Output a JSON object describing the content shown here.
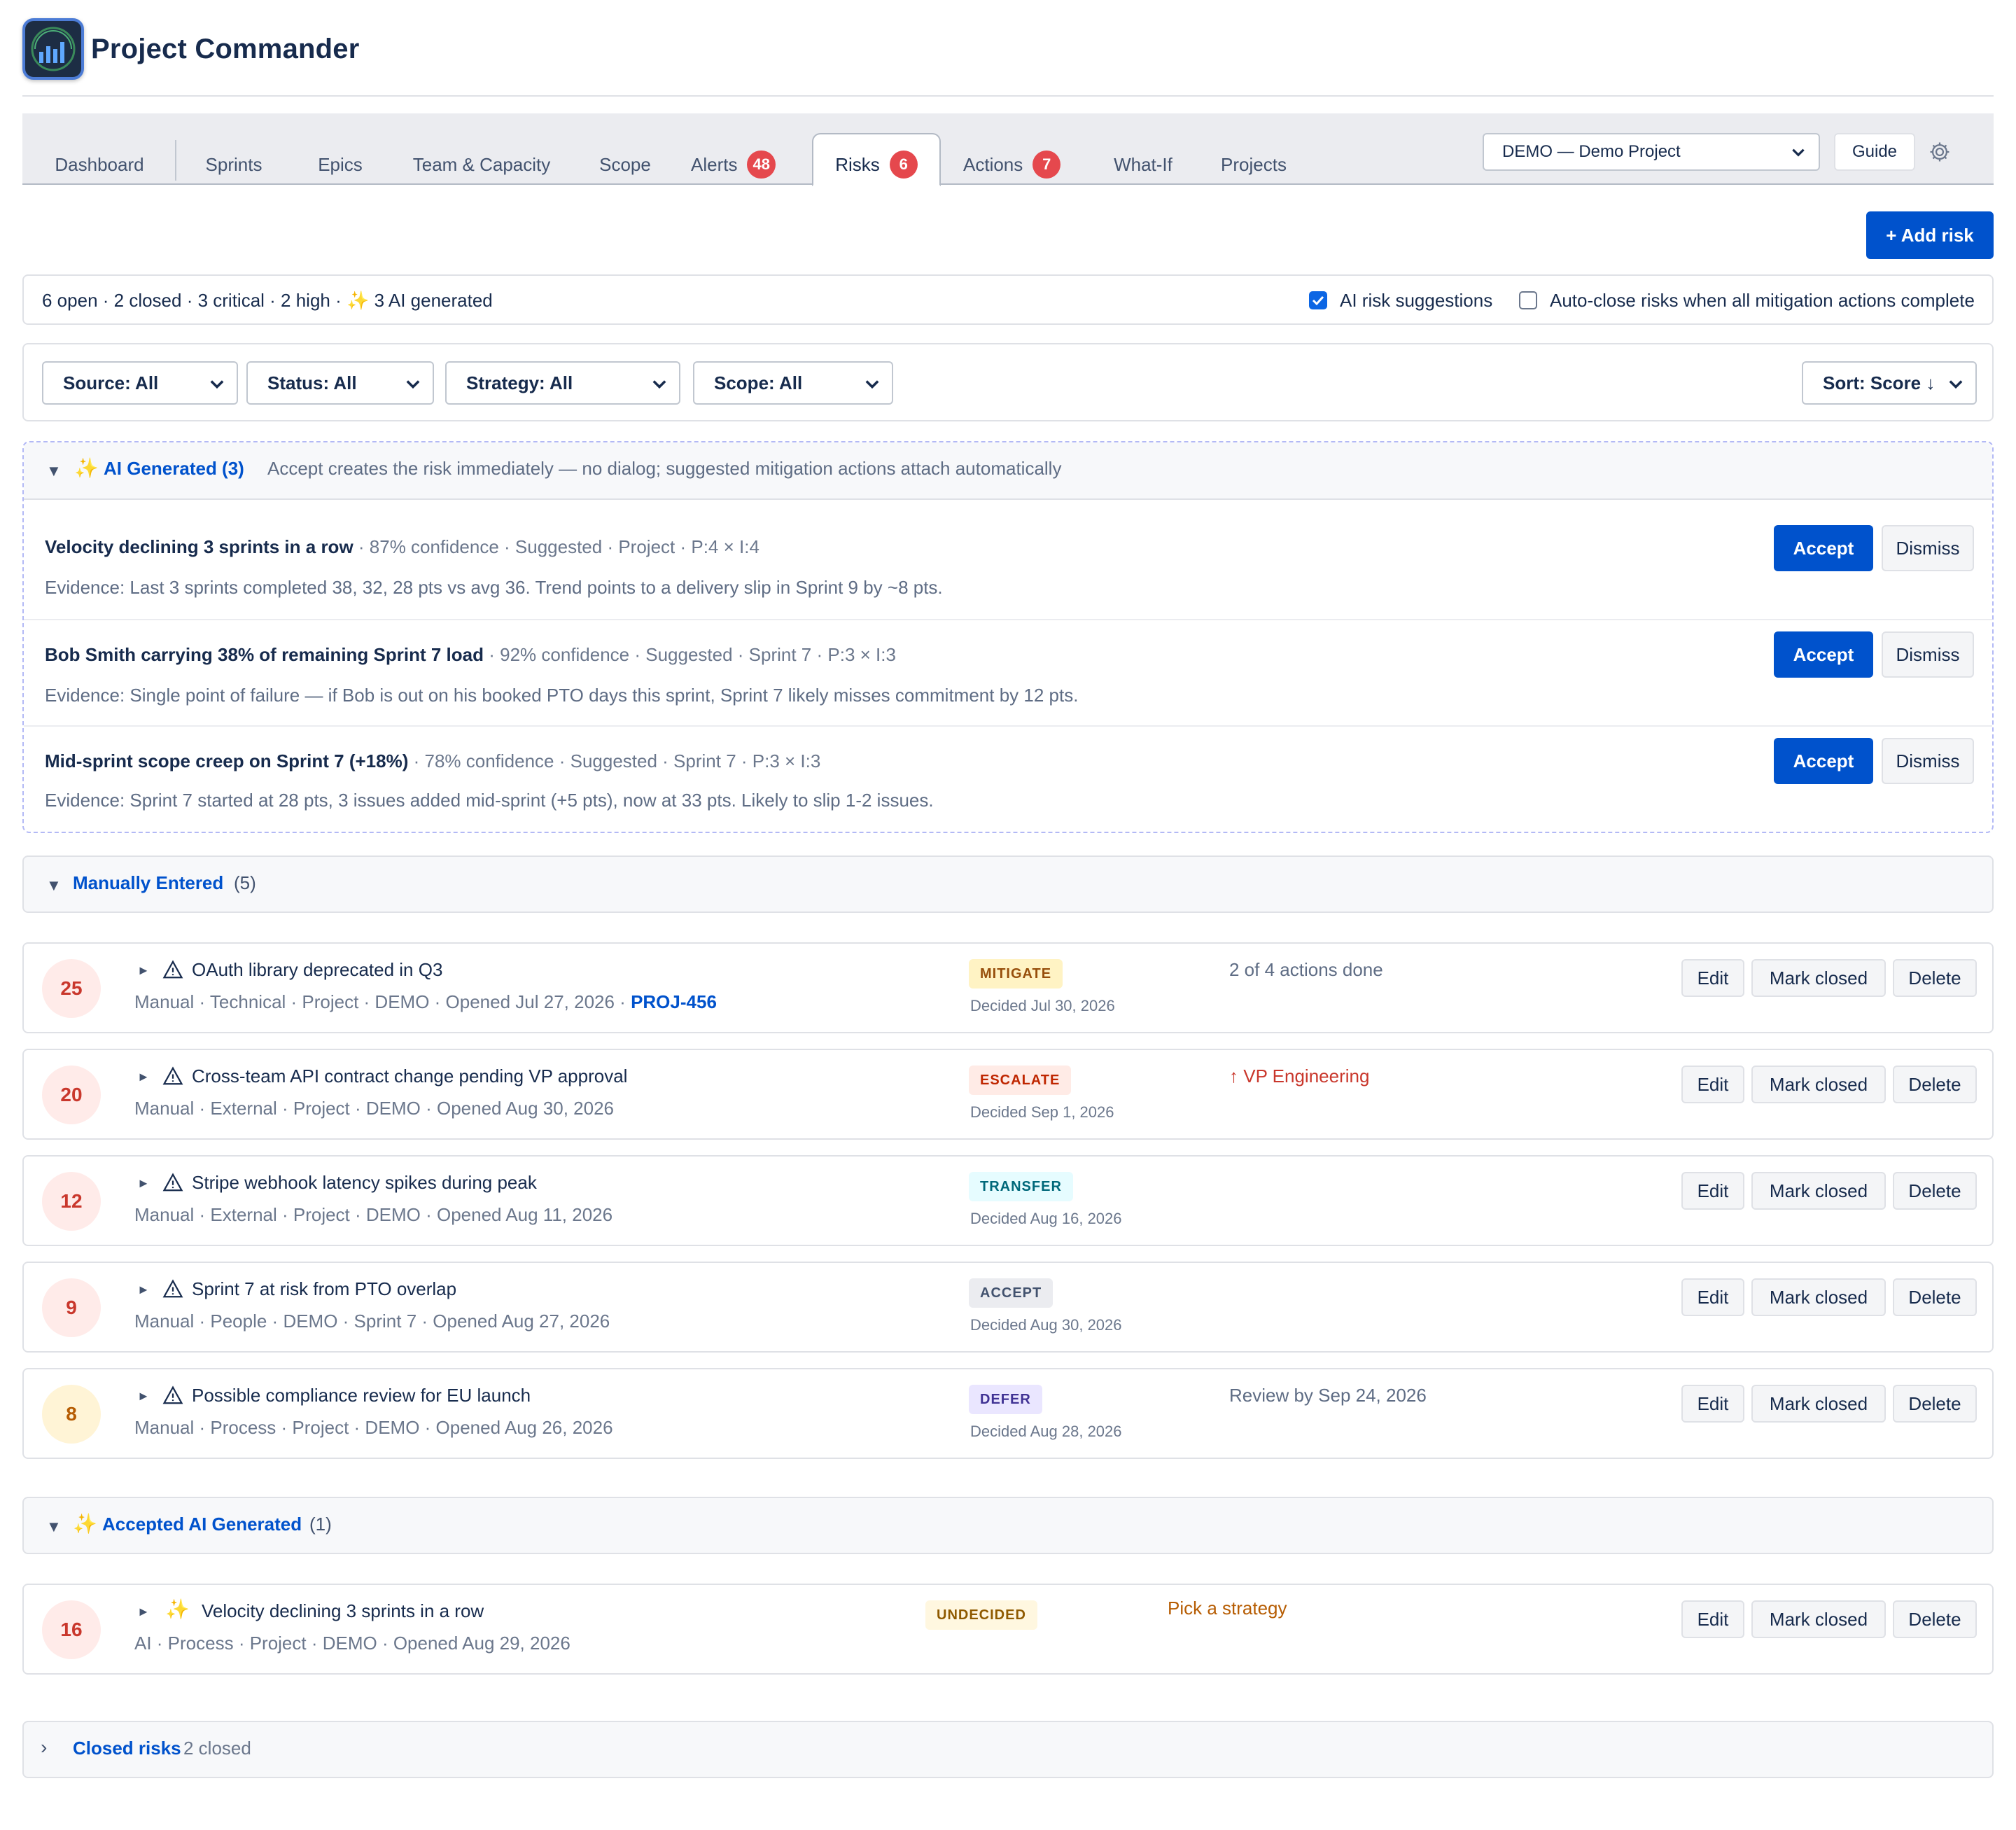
{
  "app": {
    "title": "Project Commander"
  },
  "tabs": [
    {
      "label": "Dashboard"
    },
    {
      "label": "Sprints"
    },
    {
      "label": "Epics"
    },
    {
      "label": "Team & Capacity"
    },
    {
      "label": "Scope"
    },
    {
      "label": "Alerts",
      "badge": "48"
    },
    {
      "label": "Risks",
      "badge": "6",
      "active": true
    },
    {
      "label": "Actions",
      "badge": "7"
    },
    {
      "label": "What-If"
    },
    {
      "label": "Projects"
    }
  ],
  "toolbar": {
    "project_select": "DEMO — Demo Project",
    "guide_label": "Guide",
    "settings_icon": "gear-icon",
    "add_risk_label": "+ Add risk"
  },
  "summary": {
    "stats": "6 open · 2 closed · 3 critical · 2 high ·",
    "ai_generated": "3 AI generated",
    "ai_suggestions_label": "AI risk suggestions",
    "ai_suggestions_checked": true,
    "auto_close_label": "Auto-close risks when all mitigation actions complete",
    "auto_close_checked": false
  },
  "filters": {
    "source": "Source: All",
    "status": "Status: All",
    "strategy": "Strategy: All",
    "scope": "Scope: All",
    "sort": "Sort: Score ↓"
  },
  "ai_section": {
    "title": "AI Generated (3)",
    "description": "Accept creates the risk immediately — no dialog; suggested mitigation actions attach automatically",
    "accept_label": "Accept",
    "dismiss_label": "Dismiss",
    "items": [
      {
        "title": "Velocity declining 3 sprints in a row",
        "meta": " · 87% confidence · Suggested · Project · P:4 × I:4",
        "evidence": "Evidence: Last 3 sprints completed 38, 32, 28 pts vs avg 36. Trend points to a delivery slip in Sprint 9 by ~8 pts."
      },
      {
        "title": "Bob Smith carrying 38% of remaining Sprint 7 load",
        "meta": " · 92% confidence · Suggested · Sprint 7 · P:3 × I:3",
        "evidence": "Evidence: Single point of failure — if Bob is out on his booked PTO days this sprint, Sprint 7 likely misses commitment by 12 pts."
      },
      {
        "title": "Mid-sprint scope creep on Sprint 7 (+18%)",
        "meta": " · 78% confidence · Suggested · Sprint 7 · P:3 × I:3",
        "evidence": "Evidence: Sprint 7 started at 28 pts, 3 issues added mid-sprint (+5 pts), now at 33 pts. Likely to slip 1-2 issues."
      }
    ]
  },
  "manual_section": {
    "title": "Manually Entered",
    "count": "(5)"
  },
  "risk_actions": {
    "edit": "Edit",
    "mark_closed": "Mark closed",
    "delete": "Delete"
  },
  "manual_risks": [
    {
      "score": "25",
      "title": "OAuth library deprecated in Q3",
      "meta": "Manual · Technical · Project · DEMO · Opened Jul 27, 2026 · ",
      "link": "PROJ-456",
      "strategy": "MITIGATE",
      "decided": "Decided Jul 30, 2026",
      "note": "2 of 4 actions done"
    },
    {
      "score": "20",
      "title": "Cross-team API contract change pending VP approval",
      "meta": "Manual · External · Project · DEMO · Opened Aug 30, 2026",
      "strategy": "ESCALATE",
      "decided": "Decided Sep 1, 2026",
      "note": "↑ VP Engineering"
    },
    {
      "score": "12",
      "title": "Stripe webhook latency spikes during peak",
      "meta": "Manual · External · Project · DEMO · Opened Aug 11, 2026",
      "strategy": "TRANSFER",
      "decided": "Decided Aug 16, 2026",
      "note": ""
    },
    {
      "score": "9",
      "title": "Sprint 7 at risk from PTO overlap",
      "meta": "Manual · People · DEMO · Sprint 7 · Opened Aug 27, 2026",
      "strategy": "ACCEPT",
      "decided": "Decided Aug 30, 2026",
      "note": ""
    },
    {
      "score": "8",
      "title": "Possible compliance review for EU launch",
      "meta": "Manual · Process · Project · DEMO · Opened Aug 26, 2026",
      "strategy": "DEFER",
      "decided": "Decided Aug 28, 2026",
      "note": "Review by Sep 24, 2026"
    }
  ],
  "accepted_section": {
    "title": "Accepted AI Generated",
    "count": "(1)"
  },
  "accepted_risks": [
    {
      "score": "16",
      "title": "Velocity declining 3 sprints in a row",
      "meta": "AI · Process · Project · DEMO · Opened Aug 29, 2026",
      "strategy": "UNDECIDED",
      "note": "Pick a strategy"
    }
  ],
  "closed_section": {
    "title": "Closed risks",
    "count": "2 closed"
  },
  "colors": {
    "primary": "#0052cc",
    "danger_badge": "#e5484d",
    "sparkle": "#f5a623"
  }
}
